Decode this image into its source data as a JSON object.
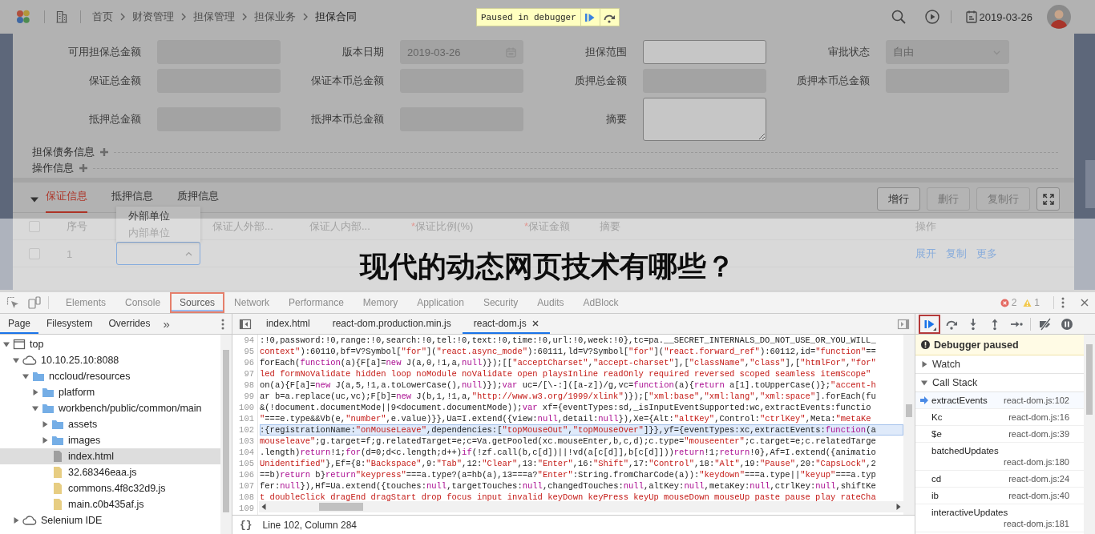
{
  "header": {
    "breadcrumbs": [
      {
        "label": "首页",
        "current": false
      },
      {
        "label": "财资管理",
        "current": false
      },
      {
        "label": "担保管理",
        "current": false
      },
      {
        "label": "担保业务",
        "current": false
      },
      {
        "label": "担保合同",
        "current": true
      }
    ],
    "date": "2019-03-26"
  },
  "paused_banner": {
    "text": "Paused in debugger"
  },
  "form": {
    "fields": [
      {
        "label": "可用担保总金额",
        "kind": "text",
        "disabled": true
      },
      {
        "label": "版本日期",
        "kind": "date",
        "disabled": true,
        "value": "2019-03-26"
      },
      {
        "label": "担保范围",
        "kind": "text",
        "disabled": false
      },
      {
        "label": "审批状态",
        "kind": "select",
        "disabled": true,
        "value": "自由"
      },
      {
        "label": "保证总金额",
        "kind": "text",
        "disabled": true
      },
      {
        "label": "保证本币总金额",
        "kind": "text",
        "disabled": true
      },
      {
        "label": "质押总金额",
        "kind": "text",
        "disabled": true
      },
      {
        "label": "质押本币总金额",
        "kind": "text",
        "disabled": true
      },
      {
        "label": "抵押总金额",
        "kind": "text",
        "disabled": true
      },
      {
        "label": "抵押本币总金额",
        "kind": "text",
        "disabled": true
      },
      {
        "label": "摘要",
        "kind": "textarea",
        "disabled": false
      }
    ],
    "sections": [
      {
        "label": "担保债务信息",
        "expanded": false
      },
      {
        "label": "操作信息",
        "expanded": false
      }
    ]
  },
  "detail": {
    "expanded": true,
    "tabs": [
      {
        "label": "保证信息",
        "selected": true
      },
      {
        "label": "抵押信息",
        "selected": false
      },
      {
        "label": "质押信息",
        "selected": false
      }
    ],
    "buttons": [
      {
        "label": "增行",
        "disabled": false
      },
      {
        "label": "删行",
        "disabled": true
      },
      {
        "label": "复制行",
        "disabled": true
      }
    ],
    "header_checked": false,
    "columns": [
      {
        "label": "序号"
      },
      {
        "label": "保证人外部..."
      },
      {
        "label": "保证人内部..."
      },
      {
        "label": "保证比例(%)",
        "required_mark": "*"
      },
      {
        "label": "保证金额",
        "required_mark": "*"
      },
      {
        "label": "摘要"
      },
      {
        "label": "操作"
      }
    ],
    "rows": [
      {
        "checked": false,
        "index": "1",
        "actions": [
          "展开",
          "复制",
          "更多"
        ]
      }
    ],
    "dropdown": {
      "options": [
        {
          "label": "外部单位",
          "selected": false
        },
        {
          "label": "内部单位",
          "selected": false
        }
      ]
    }
  },
  "overlay": {
    "title": "现代的动态网页技术有哪些？"
  },
  "devtools": {
    "tabs": [
      {
        "label": "Elements",
        "selected": false,
        "annotated": false
      },
      {
        "label": "Console",
        "selected": false,
        "annotated": false
      },
      {
        "label": "Sources",
        "selected": true,
        "annotated": true
      },
      {
        "label": "Network",
        "selected": false,
        "annotated": false
      },
      {
        "label": "Performance",
        "selected": false,
        "annotated": false
      },
      {
        "label": "Memory",
        "selected": false,
        "annotated": false
      },
      {
        "label": "Application",
        "selected": false,
        "annotated": false
      },
      {
        "label": "Security",
        "selected": false,
        "annotated": false
      },
      {
        "label": "Audits",
        "selected": false,
        "annotated": false
      },
      {
        "label": "AdBlock",
        "selected": false,
        "annotated": false
      }
    ],
    "errors": "2",
    "warnings": "1",
    "navigator": {
      "tabs": [
        {
          "label": "Page",
          "selected": true
        },
        {
          "label": "Filesystem",
          "selected": false
        },
        {
          "label": "Overrides",
          "selected": false
        }
      ],
      "more": "»",
      "tree": [
        {
          "label": "top",
          "kind": "frame",
          "expanded": true,
          "selected": false,
          "children": [
            {
              "label": "10.10.25.10:8088",
              "kind": "origin",
              "expanded": true,
              "selected": false,
              "children": [
                {
                  "label": "nccloud/resources",
                  "kind": "folder",
                  "expanded": true,
                  "selected": false,
                  "children": [
                    {
                      "label": "platform",
                      "kind": "folder",
                      "expanded": false,
                      "selected": false
                    },
                    {
                      "label": "workbench/public/common/main",
                      "kind": "folder",
                      "expanded": true,
                      "selected": false,
                      "children": [
                        {
                          "label": "assets",
                          "kind": "folder",
                          "expanded": false,
                          "selected": false
                        },
                        {
                          "label": "images",
                          "kind": "folder",
                          "expanded": false,
                          "selected": false
                        },
                        {
                          "label": "index.html",
                          "kind": "document",
                          "selected": true
                        },
                        {
                          "label": "32.68346eaa.js",
                          "kind": "script",
                          "selected": false
                        },
                        {
                          "label": "commons.4f8c32d9.js",
                          "kind": "script",
                          "selected": false
                        },
                        {
                          "label": "main.c0b435af.js",
                          "kind": "script",
                          "selected": false
                        }
                      ]
                    }
                  ]
                }
              ]
            },
            {
              "label": "Selenium IDE",
              "kind": "origin",
              "expanded": false,
              "selected": false
            }
          ]
        }
      ]
    },
    "editor": {
      "tabs": [
        {
          "label": "index.html",
          "selected": false,
          "closable": false
        },
        {
          "label": "react-dom.production.min.js",
          "selected": false,
          "closable": false
        },
        {
          "label": "react-dom.js",
          "selected": true,
          "closable": true
        }
      ],
      "lines": [
        {
          "number": "94",
          "text": ":!0,password:!0,range:!0,search:!0,tel:!0,text:!0,time:!0,url:!0,week:!0},tc=pa.__SECRET_INTERNALS_DO_NOT_USE_OR_YOU_WILL_",
          "open_string": false,
          "current": false
        },
        {
          "number": "95",
          "text": "context\"):60110,bf=V?Symbol[\"for\"](\"react.async_mode\"):60111,ld=V?Symbol[\"for\"](\"react.forward_ref\"):60112,id=\"function\"==",
          "open_string": true,
          "current": false
        },
        {
          "number": "96",
          "text": "forEach(function(a){F[a]=new J(a,0,!1,a,null)});[[\"acceptCharset\",\"accept-charset\"],[\"className\",\"class\"],[\"htmlFor\",\"for\"",
          "open_string": false,
          "current": false
        },
        {
          "number": "97",
          "text": "led formNoValidate hidden loop noModule noValidate open playsInline readOnly required reversed scoped seamless itemScope\"",
          "open_string": true,
          "current": false
        },
        {
          "number": "98",
          "text": "on(a){F[a]=new J(a,5,!1,a.toLowerCase(),null)});var uc=/[\\-:]([a-z])/g,vc=function(a){return a[1].toUpperCase()};\"accent-h",
          "open_string": false,
          "current": false
        },
        {
          "number": "99",
          "text": "ar b=a.replace(uc,vc);F[b]=new J(b,1,!1,a,\"http://www.w3.org/1999/xlink\")});[\"xml:base\",\"xml:lang\",\"xml:space\"].forEach(fu",
          "open_string": false,
          "current": false
        },
        {
          "number": "100",
          "text": "&(!document.documentMode||9<document.documentMode));var xf={eventTypes:sd,_isInputEventSupported:wc,extractEvents:functio",
          "open_string": false,
          "current": false
        },
        {
          "number": "101",
          "text": "\"===e.type&&Vb(e,\"number\",e.value)}},Ua=I.extend({view:null,detail:null}),Xe={Alt:\"altKey\",Control:\"ctrlKey\",Meta:\"metaKe",
          "open_string": true,
          "current": false
        },
        {
          "number": "102",
          "text": ":{registrationName:\"onMouseLeave\",dependencies:[\"topMouseOut\",\"topMouseOver\"]}},yf={eventTypes:xc,extractEvents:function(a",
          "open_string": false,
          "current": true
        },
        {
          "number": "103",
          "text": "mouseleave\";g.target=f;g.relatedTarget=e;c=Va.getPooled(xc.mouseEnter,b,c,d);c.type=\"mouseenter\";c.target=e;c.relatedTarge",
          "open_string": true,
          "current": false
        },
        {
          "number": "104",
          "text": ".length)return!1;for(d=0;d<c.length;d++)if(!zf.call(b,c[d])||!vd(a[c[d]],b[c[d]]))return!1;return!0},Af=I.extend({animatio",
          "open_string": false,
          "current": false
        },
        {
          "number": "105",
          "text": "Unidentified\"},Ef={8:\"Backspace\",9:\"Tab\",12:\"Clear\",13:\"Enter\",16:\"Shift\",17:\"Control\",18:\"Alt\",19:\"Pause\",20:\"CapsLock\",2",
          "open_string": true,
          "current": false
        },
        {
          "number": "106",
          "text": "==b)return b}return\"keypress\"===a.type?(a=hb(a),13===a?\"Enter\":String.fromCharCode(a)):\"keydown\"===a.type||\"keyup\"===a.typ",
          "open_string": false,
          "current": false
        },
        {
          "number": "107",
          "text": "fer:null}),Hf=Ua.extend({touches:null,targetTouches:null,changedTouches:null,altKey:null,metaKey:null,ctrlKey:null,shiftKe",
          "open_string": false,
          "current": false
        },
        {
          "number": "108",
          "text": "t doubleClick dragEnd dragStart drop focus input invalid keyDown keyPress keyUp mouseDown mouseUp paste pause play rateCha",
          "open_string": true,
          "current": false
        },
        {
          "number": "109",
          "current": false
        }
      ],
      "format_button": "{}",
      "status": "Line 102, Column 284"
    },
    "debugger": {
      "toolbar": [
        {
          "kind": "resume",
          "annotated": true
        },
        {
          "kind": "step-over",
          "annotated": false
        },
        {
          "kind": "step-into",
          "annotated": false
        },
        {
          "kind": "step-out",
          "annotated": false
        },
        {
          "kind": "step",
          "annotated": false
        },
        {
          "kind": "deactivate",
          "annotated": false
        },
        {
          "kind": "pause-exceptions",
          "annotated": false
        }
      ],
      "notice": "Debugger paused",
      "sections": [
        {
          "label": "Watch",
          "expanded": false
        },
        {
          "label": "Call Stack",
          "expanded": true,
          "frames": [
            {
              "name": "extractEvents",
              "location": "react-dom.js:102",
              "selected": true
            },
            {
              "name": "Kc",
              "location": "react-dom.js:16",
              "selected": false
            },
            {
              "name": "$e",
              "location": "react-dom.js:39",
              "selected": false
            },
            {
              "name": "batchedUpdates",
              "location": "react-dom.js:180",
              "selected": false
            },
            {
              "name": "cd",
              "location": "react-dom.js:24",
              "selected": false
            },
            {
              "name": "ib",
              "location": "react-dom.js:40",
              "selected": false
            },
            {
              "name": "interactiveUpdates",
              "location": "react-dom.js:181",
              "selected": false
            }
          ]
        }
      ]
    }
  }
}
